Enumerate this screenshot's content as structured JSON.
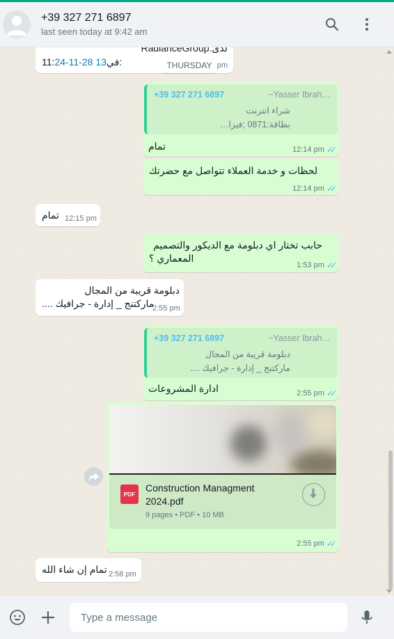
{
  "header": {
    "contact_name": "+39 327 271 6897",
    "status": "last seen today at 9:42 am",
    "icons": [
      "avatar",
      "search-icon",
      "menu-icon"
    ]
  },
  "messages": {
    "m0": {
      "line1": "لدى:RadianceGroup",
      "line2_prefix": "في:",
      "line2_time_a": "11:",
      "line2_time_b": "24-11-28",
      "line2_time_c": "13",
      "time": "pm"
    },
    "day_label": "THURSDAY",
    "m1": {
      "quote_number": "+39 327 271 6897",
      "quote_name": "~Yasser Ibrah…",
      "quote_line1": "شراء انترنت",
      "quote_line2": "بطاقة:0871 ;فيزا…",
      "text": "تمام",
      "time": "12:14 pm"
    },
    "m2": {
      "text": "لحظات و خدمة العملاء تتواصل مع حضرتك",
      "time": "12:14 pm"
    },
    "m3": {
      "text": "تمام",
      "time": "12:15 pm"
    },
    "m4": {
      "line1": "حابب تختار اي دبلومة مع الديكور والتصميم",
      "line2": "المعماري ؟",
      "time": "1:53 pm"
    },
    "m5": {
      "line1": "دبلومة قريبة من المجال",
      "line2": "ماركتنج _ إدارة - جرافيك ....",
      "time": "2:55 pm"
    },
    "m6": {
      "quote_number": "+39 327 271 6897",
      "quote_name": "~Yasser Ibrah…",
      "quote_line1": "دبلومة قريبة من المجال",
      "quote_line2": "ماركتنج _ إدارة - جرافيك ....",
      "text": "ادارة المشروعات",
      "time": "2:55 pm"
    },
    "m7": {
      "file_icon_label": "PDF",
      "file_name": "Construction Managment 2024.pdf",
      "file_meta": "9 pages • PDF • 10 MB",
      "time": "2:55 pm"
    },
    "m8": {
      "text": "تمام إن شاء الله",
      "time": "2:58 pm"
    }
  },
  "composer": {
    "placeholder": "Type a message",
    "icons": [
      "emoji-icon",
      "attach-icon",
      "mic-icon"
    ]
  },
  "colors": {
    "accent": "#00a884",
    "incoming_bubble": "#ffffff",
    "outgoing_bubble": "#d9fdd3",
    "read_ticks": "#53bdeb",
    "chat_background": "#efeae2"
  }
}
